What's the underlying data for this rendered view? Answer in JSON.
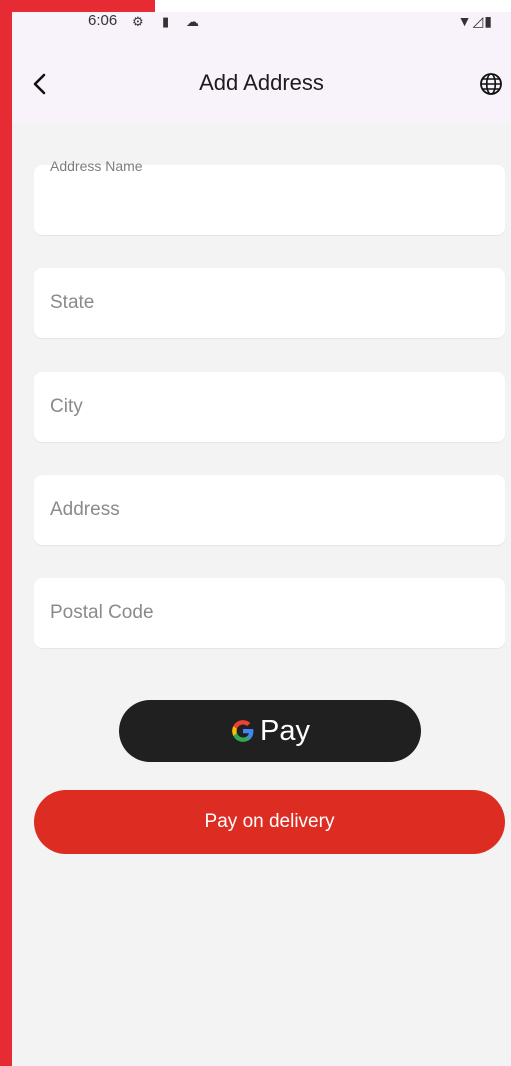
{
  "status_bar": {
    "time": "6:06",
    "icons_left": [
      "settings-icon",
      "sim-card-icon",
      "cloud-icon"
    ],
    "icons_right": [
      "wifi-icon",
      "signal-icon",
      "battery-icon"
    ]
  },
  "app_bar": {
    "title": "Add Address",
    "back_icon": "chevron-left-icon",
    "language_icon": "globe-icon"
  },
  "form": {
    "address_name": {
      "label": "Address Name",
      "value": ""
    },
    "state": {
      "placeholder": "State",
      "value": ""
    },
    "city": {
      "placeholder": "City",
      "value": ""
    },
    "address": {
      "placeholder": "Address",
      "value": ""
    },
    "postal_code": {
      "placeholder": "Postal Code",
      "value": ""
    }
  },
  "buttons": {
    "gpay_label": "Pay",
    "pay_on_delivery_label": "Pay on delivery"
  },
  "colors": {
    "frame_red": "#e62b35",
    "app_bar_bg": "#f8f2fa",
    "screen_bg": "#f3f3f3",
    "gpay_bg": "#202020",
    "pay_on_delivery_bg": "#dd2c22"
  }
}
